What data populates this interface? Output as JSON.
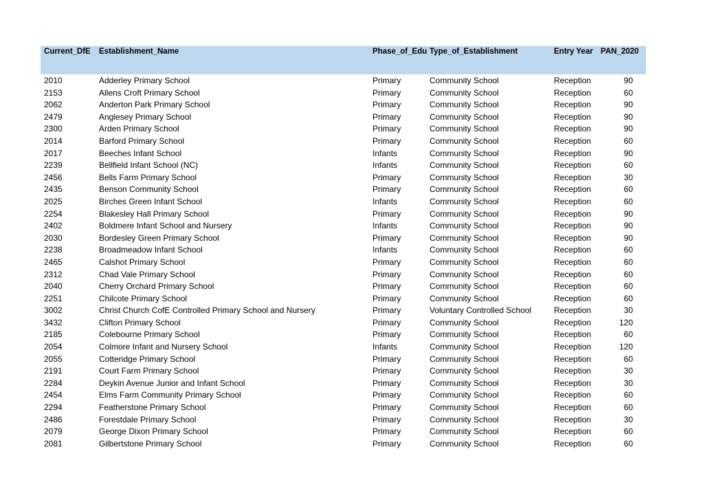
{
  "header": {
    "columns": [
      "Current_DfE",
      "Establishment_Name",
      "Phase_of_Education",
      "Type_of_Establishment",
      "Entry Year",
      "PAN_2020"
    ],
    "visible_labels": [
      "Current_DfE",
      "Establishment_Name",
      "Phase_of_Edu",
      "Type_of_Establishment",
      "Entry Year",
      "PAN_2020"
    ]
  },
  "rows": [
    [
      "2010",
      "Adderley Primary School",
      "Primary",
      "Community School",
      "Reception",
      "90"
    ],
    [
      "2153",
      "Allens Croft Primary School",
      "Primary",
      "Community School",
      "Reception",
      "60"
    ],
    [
      "2062",
      "Anderton Park Primary School",
      "Primary",
      "Community School",
      "Reception",
      "90"
    ],
    [
      "2479",
      "Anglesey Primary School",
      "Primary",
      "Community School",
      "Reception",
      "90"
    ],
    [
      "2300",
      "Arden Primary School",
      "Primary",
      "Community School",
      "Reception",
      "90"
    ],
    [
      "2014",
      "Barford Primary School",
      "Primary",
      "Community School",
      "Reception",
      "60"
    ],
    [
      "2017",
      "Beeches Infant School",
      "Infants",
      "Community School",
      "Reception",
      "90"
    ],
    [
      "2239",
      "Bellfield Infant School (NC)",
      "Infants",
      "Community School",
      "Reception",
      "60"
    ],
    [
      "2456",
      "Bells Farm Primary School",
      "Primary",
      "Community School",
      "Reception",
      "30"
    ],
    [
      "2435",
      "Benson Community School",
      "Primary",
      "Community School",
      "Reception",
      "60"
    ],
    [
      "2025",
      "Birches Green Infant School",
      "Infants",
      "Community School",
      "Reception",
      "60"
    ],
    [
      "2254",
      "Blakesley Hall Primary School",
      "Primary",
      "Community School",
      "Reception",
      "90"
    ],
    [
      "2402",
      "Boldmere Infant School and Nursery",
      "Infants",
      "Community School",
      "Reception",
      "90"
    ],
    [
      "2030",
      "Bordesley Green Primary School",
      "Primary",
      "Community School",
      "Reception",
      "90"
    ],
    [
      "2238",
      "Broadmeadow Infant School",
      "Infants",
      "Community School",
      "Reception",
      "60"
    ],
    [
      "2465",
      "Calshot Primary School",
      "Primary",
      "Community School",
      "Reception",
      "60"
    ],
    [
      "2312",
      "Chad Vale Primary School",
      "Primary",
      "Community School",
      "Reception",
      "60"
    ],
    [
      "2040",
      "Cherry Orchard Primary School",
      "Primary",
      "Community School",
      "Reception",
      "60"
    ],
    [
      "2251",
      "Chilcote Primary School",
      "Primary",
      "Community School",
      "Reception",
      "60"
    ],
    [
      "3002",
      "Christ Church CofE Controlled Primary School and Nursery",
      "Primary",
      "Voluntary Controlled School",
      "Reception",
      "30"
    ],
    [
      "3432",
      "Clifton Primary School",
      "Primary",
      "Community School",
      "Reception",
      "120"
    ],
    [
      "2185",
      "Colebourne Primary School",
      "Primary",
      "Community School",
      "Reception",
      "60"
    ],
    [
      "2054",
      "Colmore Infant and Nursery School",
      "Infants",
      "Community School",
      "Reception",
      "120"
    ],
    [
      "2055",
      "Cotteridge Primary School",
      "Primary",
      "Community School",
      "Reception",
      "60"
    ],
    [
      "2191",
      "Court Farm Primary School",
      "Primary",
      "Community School",
      "Reception",
      "30"
    ],
    [
      "2284",
      "Deykin Avenue Junior and Infant School",
      "Primary",
      "Community School",
      "Reception",
      "30"
    ],
    [
      "2454",
      "Elms Farm Community Primary School",
      "Primary",
      "Community School",
      "Reception",
      "60"
    ],
    [
      "2294",
      "Featherstone Primary School",
      "Primary",
      "Community School",
      "Reception",
      "60"
    ],
    [
      "2486",
      "Forestdale Primary School",
      "Primary",
      "Community School",
      "Reception",
      "30"
    ],
    [
      "2079",
      "George Dixon Primary School",
      "Primary",
      "Community School",
      "Reception",
      "60"
    ],
    [
      "2081",
      "Gilbertstone Primary School",
      "Primary",
      "Community School",
      "Reception",
      "60"
    ]
  ]
}
